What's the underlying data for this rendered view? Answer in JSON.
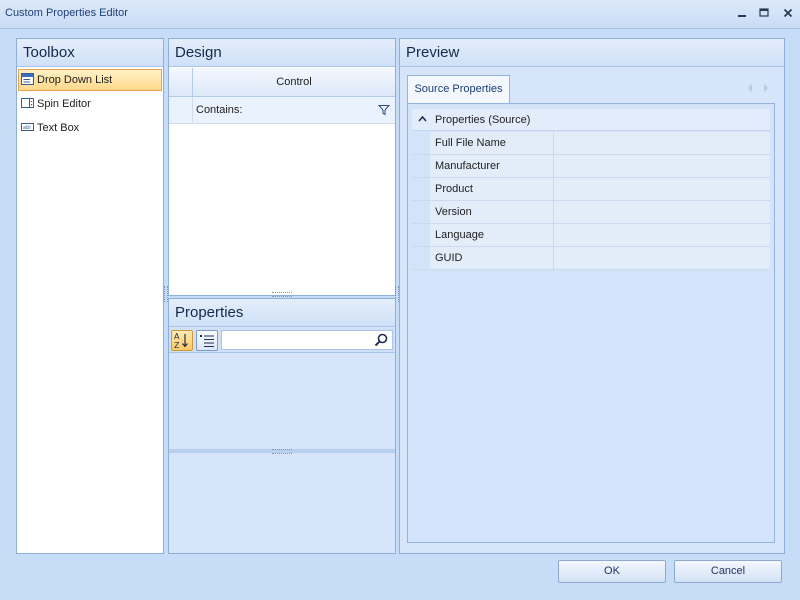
{
  "window": {
    "title": "Custom Properties Editor"
  },
  "toolbox": {
    "title": "Toolbox",
    "items": [
      {
        "label": "Drop Down List",
        "icon": "dropdown-list-icon",
        "selected": true
      },
      {
        "label": "Spin Editor",
        "icon": "spin-editor-icon",
        "selected": false
      },
      {
        "label": "Text Box",
        "icon": "text-box-icon",
        "selected": false
      }
    ]
  },
  "design": {
    "title": "Design",
    "column_header": "Control",
    "filter_label": "Contains:"
  },
  "properties": {
    "title": "Properties",
    "search_value": ""
  },
  "preview": {
    "title": "Preview",
    "tab_label": "Source Properties",
    "group_label": "Properties (Source)",
    "rows": [
      {
        "name": "Full File Name",
        "value": ""
      },
      {
        "name": "Manufacturer",
        "value": ""
      },
      {
        "name": "Product",
        "value": ""
      },
      {
        "name": "Version",
        "value": ""
      },
      {
        "name": "Language",
        "value": ""
      },
      {
        "name": "GUID",
        "value": ""
      }
    ]
  },
  "buttons": {
    "ok": "OK",
    "cancel": "Cancel"
  },
  "colors": {
    "background": "#c6dcf7",
    "selection": "#ffd98a",
    "panel_border": "#8eaedb"
  }
}
